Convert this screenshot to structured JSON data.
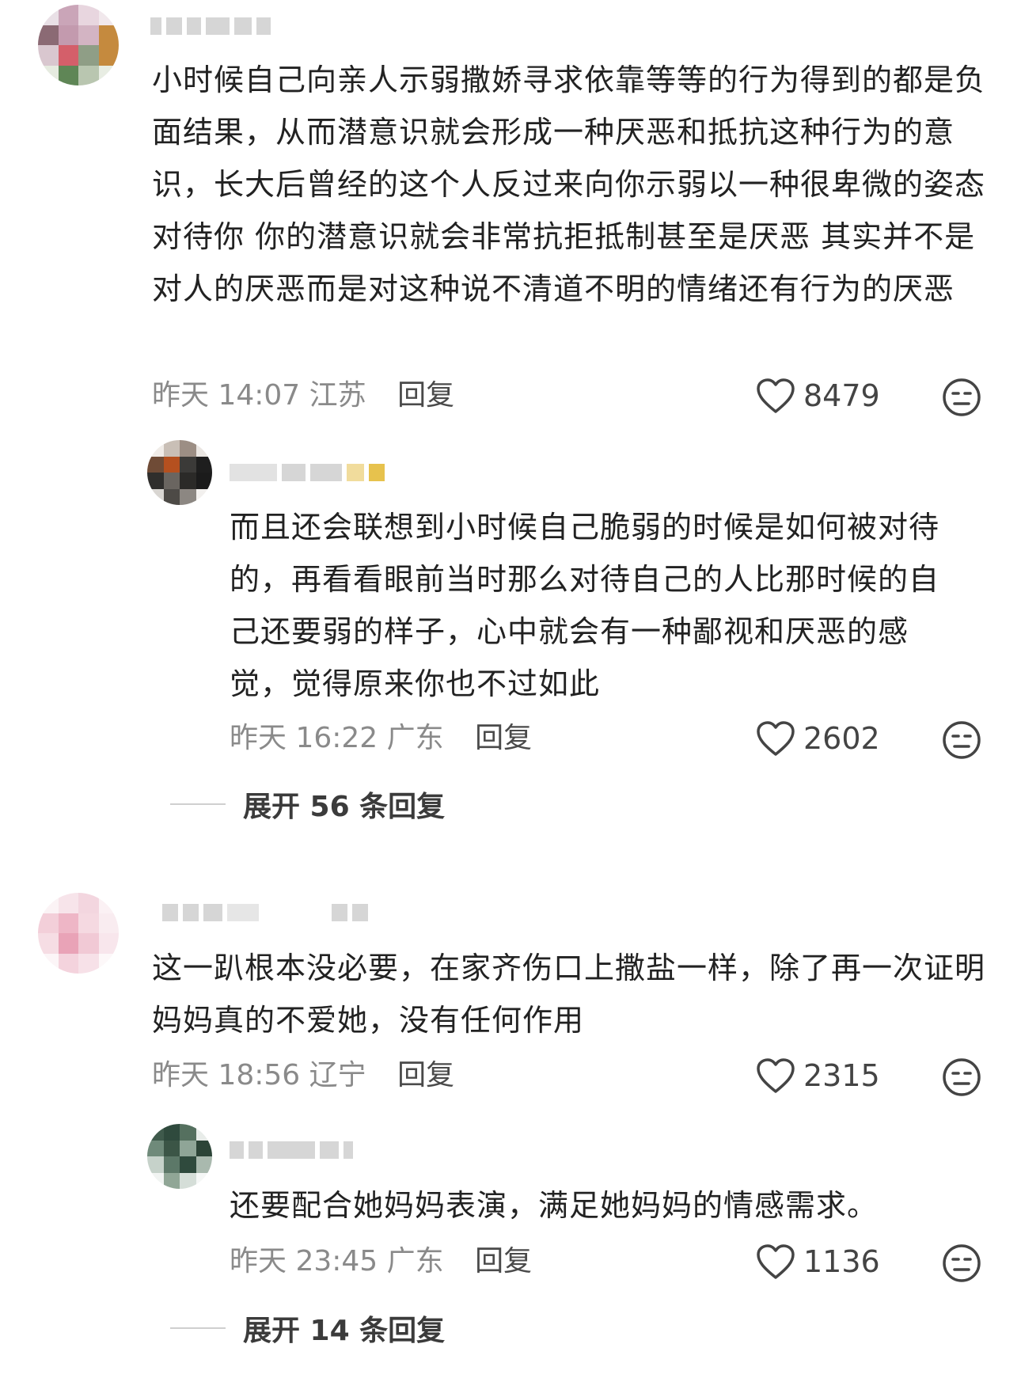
{
  "comments": [
    {
      "text": "小时候自己向亲人示弱撒娇寻求依靠等等的行为得到的都是负面结果，从而潜意识就会形成一种厌恶和抵抗这种行为的意识，长大后曾经的这个人反过来向你示弱以一种很卑微的姿态对待你 你的潜意识就会非常抗拒抵制甚至是厌恶 其实并不是对人的厌恶而是对这种说不清道不明的情绪还有行为的厌恶",
      "time": "昨天 14:07",
      "location": "江苏",
      "reply_label": "回复",
      "likes": "8479",
      "reply": {
        "text": "而且还会联想到小时候自己脆弱的时候是如何被对待的，再看看眼前当时那么对待自己的人比那时候的自己还要弱的样子，心中就会有一种鄙视和厌恶的感觉，觉得原来你也不过如此",
        "time": "昨天 16:22",
        "location": "广东",
        "reply_label": "回复",
        "likes": "2602"
      },
      "expand_label": "展开 56 条回复"
    },
    {
      "text": "这一趴根本没必要，在家齐伤口上撒盐一样，除了再一次证明妈妈真的不爱她，没有任何作用",
      "time": "昨天 18:56",
      "location": "辽宁",
      "reply_label": "回复",
      "likes": "2315",
      "reply": {
        "text": "还要配合她妈妈表演，满足她妈妈的情感需求。",
        "time": "昨天 23:45",
        "location": "广东",
        "reply_label": "回复",
        "likes": "1136"
      },
      "expand_label": "展开 14 条回复"
    }
  ],
  "icons": {
    "like": "heart-outline-icon",
    "reaction": "neutral-face-icon"
  },
  "colors": {
    "text": "#222222",
    "meta": "#8a8a8a",
    "icon": "#444444"
  }
}
